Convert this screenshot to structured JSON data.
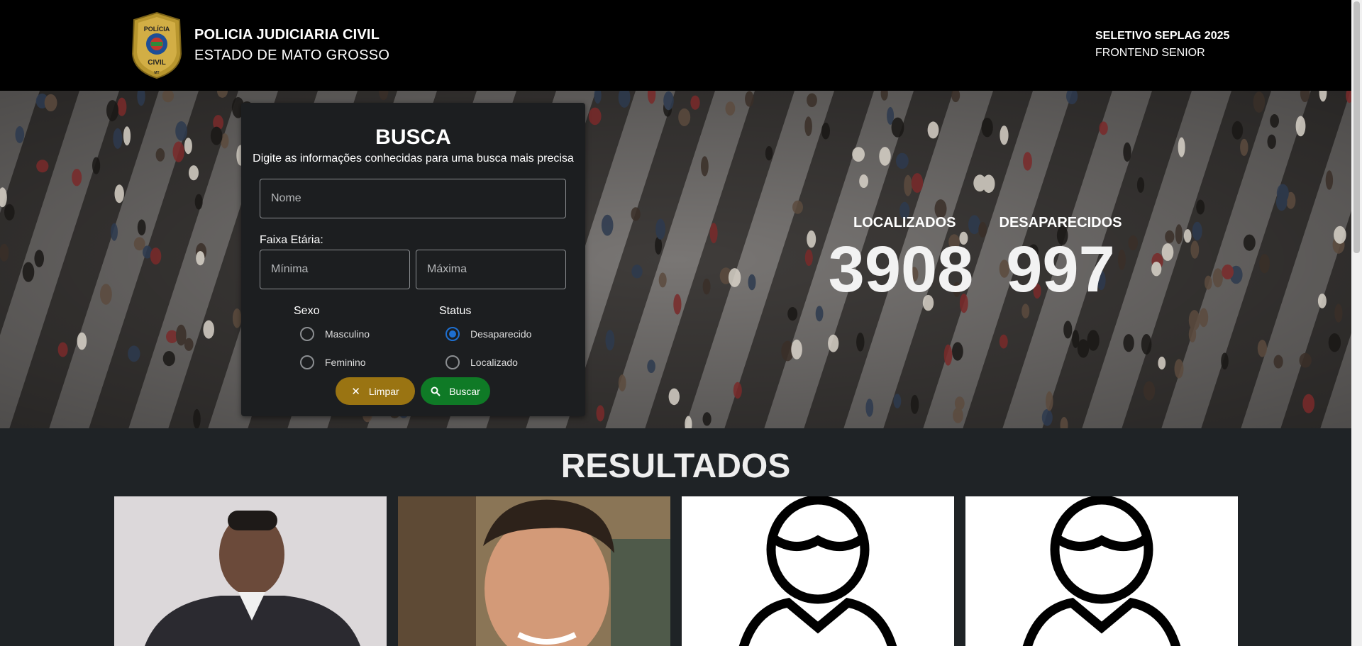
{
  "header": {
    "org_line1": "POLICIA JUDICIARIA CIVIL",
    "org_line2": "ESTADO DE MATO GROSSO",
    "badge_text_top": "POLÍCIA",
    "badge_text_bottom": "CIVIL",
    "badge_text_small": "MT",
    "right_line1": "SELETIVO SEPLAG 2025",
    "right_line2": "FRONTEND SENIOR"
  },
  "search": {
    "title": "BUSCA",
    "subtitle": "Digite as informações conhecidas para uma busca mais precisa",
    "name_placeholder": "Nome",
    "age_label": "Faixa Etária:",
    "min_placeholder": "Mínima",
    "max_placeholder": "Máxima",
    "sex_label": "Sexo",
    "sex_options": [
      "Masculino",
      "Feminino"
    ],
    "status_label": "Status",
    "status_options": [
      "Desaparecido",
      "Localizado"
    ],
    "status_selected": "Desaparecido",
    "clear_label": "Limpar",
    "search_label": "Buscar",
    "colors": {
      "clear": "#9a7412",
      "search": "#0f7a26",
      "radio_selected": "#1e6fd0"
    }
  },
  "stats": {
    "found_label": "LOCALIZADOS",
    "found_value": "3908",
    "missing_label": "DESAPARECIDOS",
    "missing_value": "997"
  },
  "results": {
    "title": "RESULTADOS",
    "cards": [
      {
        "type": "photo",
        "icon": "person-photo"
      },
      {
        "type": "photo",
        "icon": "person-photo"
      },
      {
        "type": "placeholder",
        "icon": "user-silhouette-icon"
      },
      {
        "type": "placeholder",
        "icon": "user-silhouette-icon"
      }
    ]
  }
}
